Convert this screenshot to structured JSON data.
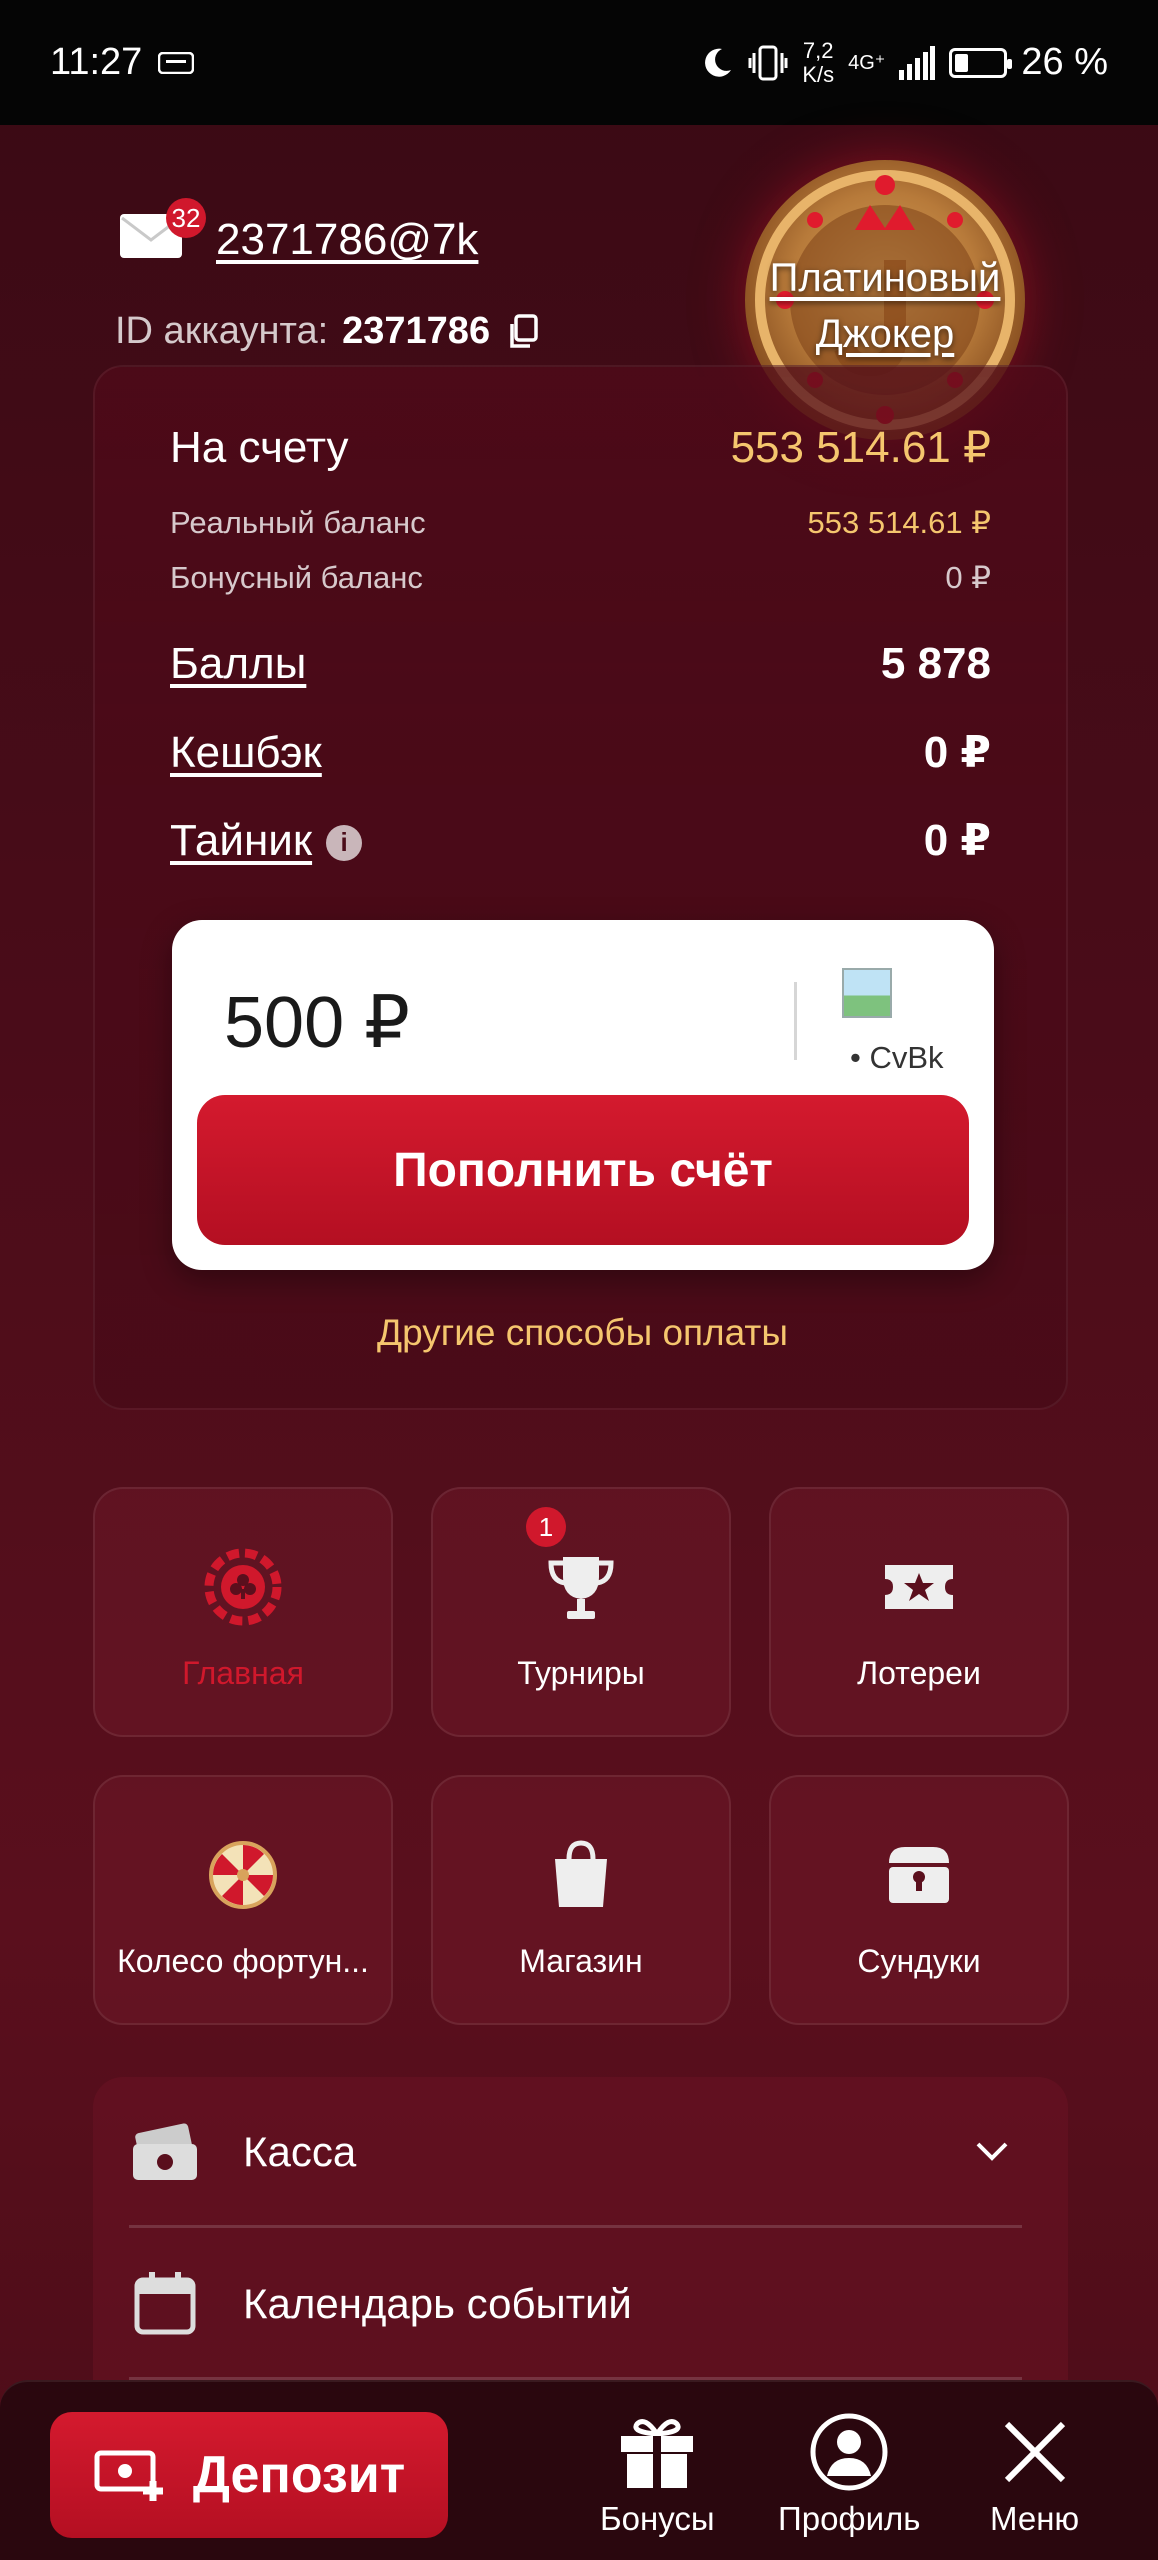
{
  "status_bar": {
    "time": "11:27",
    "net_speed_top": "7,2",
    "net_speed_bottom": "K/s",
    "network": "4G⁺",
    "battery": "26 %"
  },
  "header": {
    "mail_badge": "32",
    "login": "2371786@7k",
    "account_id_label": "ID аккаунта:",
    "account_id": "2371786",
    "level_line1": "Платиновый",
    "level_line2": "Джокер"
  },
  "balance": {
    "total_label": "На счету",
    "total_value": "553 514.61 ₽",
    "real_label": "Реальный баланс",
    "real_value": "553 514.61 ₽",
    "bonus_label": "Бонусный баланс",
    "bonus_value": "0 ₽",
    "points_label": "Баллы",
    "points_value": "5 878",
    "cashback_label": "Кешбэк",
    "cashback_value": "0 ₽",
    "secret_label": "Тайник",
    "secret_value": "0 ₽",
    "info_symbol": "i"
  },
  "deposit_form": {
    "amount": "500 ₽",
    "method_label": "• CvBk",
    "submit_label": "Пополнить счёт",
    "other_methods": "Другие способы оплаты"
  },
  "tiles": [
    {
      "label": "Главная",
      "icon": "casino-chip-icon",
      "active": true
    },
    {
      "label": "Турниры",
      "icon": "trophy-icon",
      "badge": "1"
    },
    {
      "label": "Лотереи",
      "icon": "ticket-icon"
    },
    {
      "label": "Колесо фортун...",
      "icon": "fortune-wheel-icon"
    },
    {
      "label": "Магазин",
      "icon": "shopping-bag-icon"
    },
    {
      "label": "Сундуки",
      "icon": "chest-icon"
    }
  ],
  "menu_list": [
    {
      "label": "Касса",
      "icon": "cash-icon",
      "expandable": true
    },
    {
      "label": "Календарь событий",
      "icon": "calendar-icon"
    }
  ],
  "bottom_nav": {
    "deposit_label": "Депозит",
    "bonuses_label": "Бонусы",
    "profile_label": "Профиль",
    "menu_label": "Меню"
  },
  "colors": {
    "accent_red": "#d0182c",
    "gold": "#f5c66e",
    "background": "#4a0c19"
  }
}
